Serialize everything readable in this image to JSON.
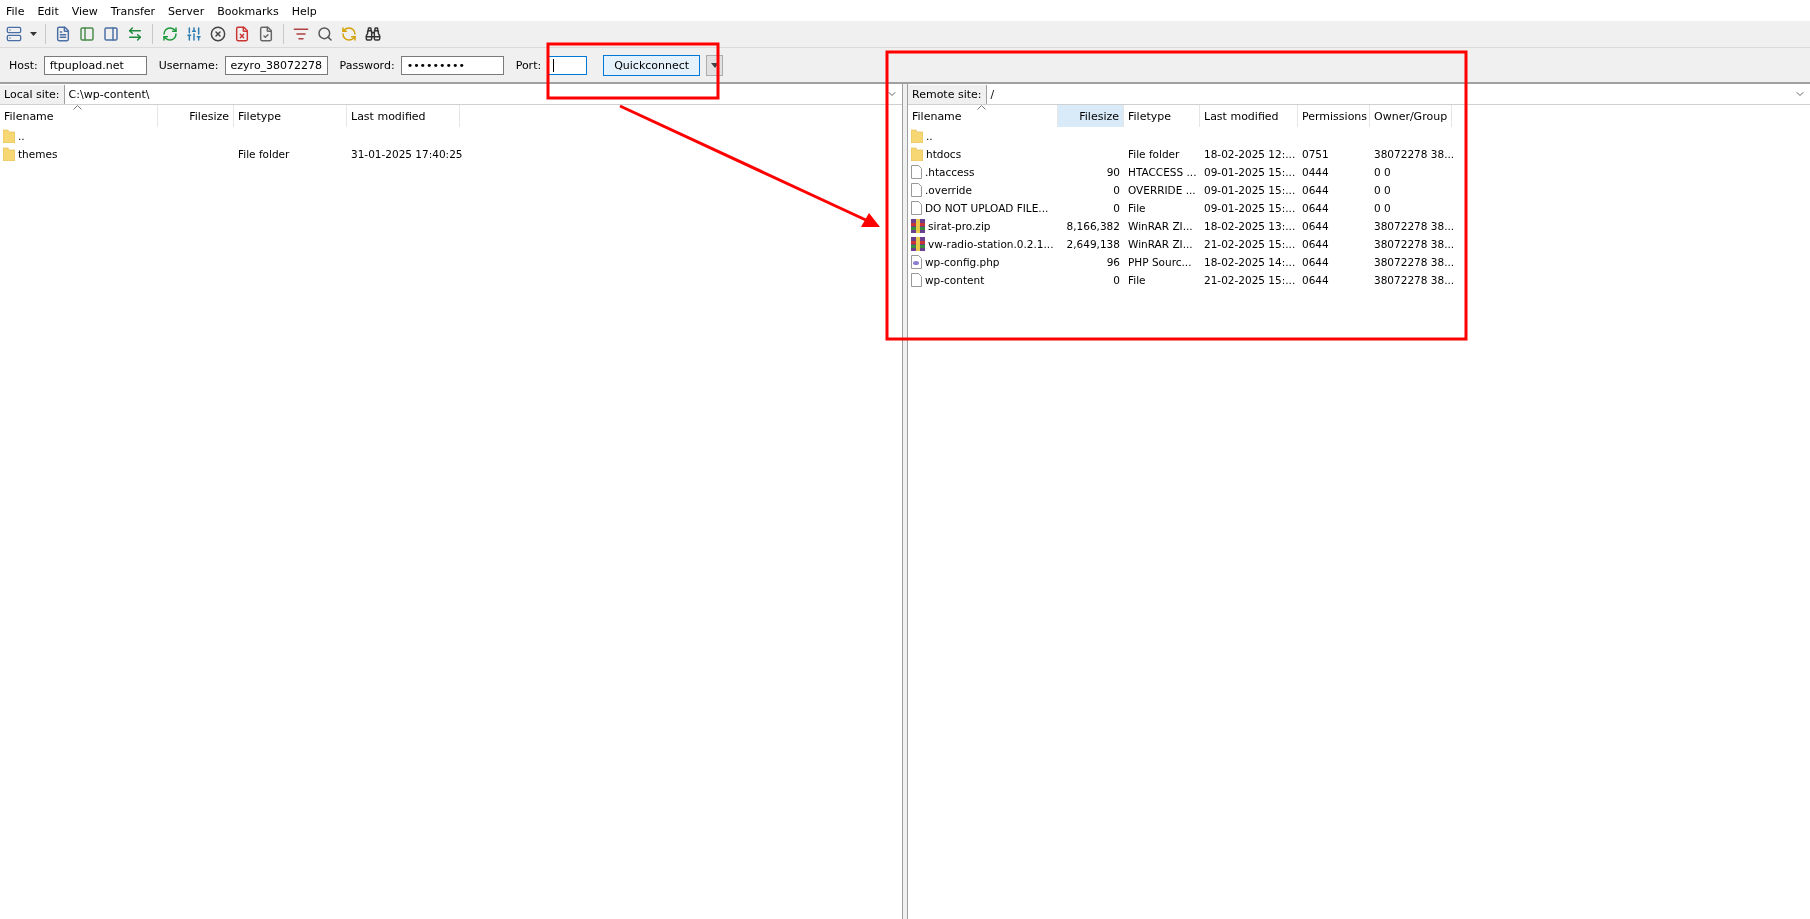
{
  "menu": [
    "File",
    "Edit",
    "View",
    "Transfer",
    "Server",
    "Bookmarks",
    "Help"
  ],
  "quickconnect": {
    "fields": [
      {
        "label": "Host:",
        "value": "ftpupload.net",
        "kind": "text",
        "focused": false
      },
      {
        "label": "Username:",
        "value": "ezyro_38072278",
        "kind": "text",
        "focused": false
      },
      {
        "label": "Password:",
        "value": "•••••••••",
        "kind": "text",
        "focused": false
      },
      {
        "label": "Port:",
        "kind": "port",
        "focused": true
      }
    ],
    "button": "Quickconnect"
  },
  "local": {
    "label": "Local site:",
    "path": "C:\\wp-content\\",
    "columns": [
      {
        "label": "Filename",
        "selected": false
      },
      {
        "label": "Filesize",
        "selected": false
      },
      {
        "label": "Filetype",
        "selected": false
      },
      {
        "label": "Last modified",
        "selected": false
      }
    ],
    "rows": [
      {
        "kind": "folder",
        "cells": [
          "..",
          "",
          "",
          ""
        ]
      },
      {
        "kind": "folder",
        "cells": [
          "themes",
          "",
          "File folder",
          "31-01-2025 17:40:25"
        ]
      }
    ]
  },
  "remote": {
    "label": "Remote site:",
    "path": "/",
    "columns": [
      {
        "label": "Filename",
        "selected": false
      },
      {
        "label": "Filesize",
        "selected": true
      },
      {
        "label": "Filetype",
        "selected": false
      },
      {
        "label": "Last modified",
        "selected": false
      },
      {
        "label": "Permissions",
        "selected": false
      },
      {
        "label": "Owner/Group",
        "selected": false
      }
    ],
    "rows": [
      {
        "kind": "folder",
        "cells": [
          "..",
          "",
          "",
          "",
          "",
          ""
        ]
      },
      {
        "kind": "folder",
        "cells": [
          "htdocs",
          "",
          "File folder",
          "18-02-2025 12:...",
          "0751",
          "38072278 38..."
        ]
      },
      {
        "kind": "file",
        "cells": [
          ".htaccess",
          "90",
          "HTACCESS ...",
          "09-01-2025 15:...",
          "0444",
          "0 0"
        ]
      },
      {
        "kind": "file",
        "cells": [
          ".override",
          "0",
          "OVERRIDE ...",
          "09-01-2025 15:...",
          "0644",
          "0 0"
        ]
      },
      {
        "kind": "file",
        "cells": [
          "DO NOT UPLOAD FILE...",
          "0",
          "File",
          "09-01-2025 15:...",
          "0644",
          "0 0"
        ]
      },
      {
        "kind": "archive",
        "cells": [
          "sirat-pro.zip",
          "8,166,382",
          "WinRAR ZI...",
          "18-02-2025 13:...",
          "0644",
          "38072278 38..."
        ]
      },
      {
        "kind": "archive",
        "cells": [
          "vw-radio-station.0.2.1...",
          "2,649,138",
          "WinRAR ZI...",
          "21-02-2025 15:...",
          "0644",
          "38072278 38..."
        ]
      },
      {
        "kind": "php",
        "cells": [
          "wp-config.php",
          "96",
          "PHP Sourc...",
          "18-02-2025 14:...",
          "0644",
          "38072278 38..."
        ]
      },
      {
        "kind": "file",
        "cells": [
          "wp-content",
          "0",
          "File",
          "21-02-2025 15:...",
          "0644",
          "38072278 38..."
        ]
      }
    ]
  }
}
